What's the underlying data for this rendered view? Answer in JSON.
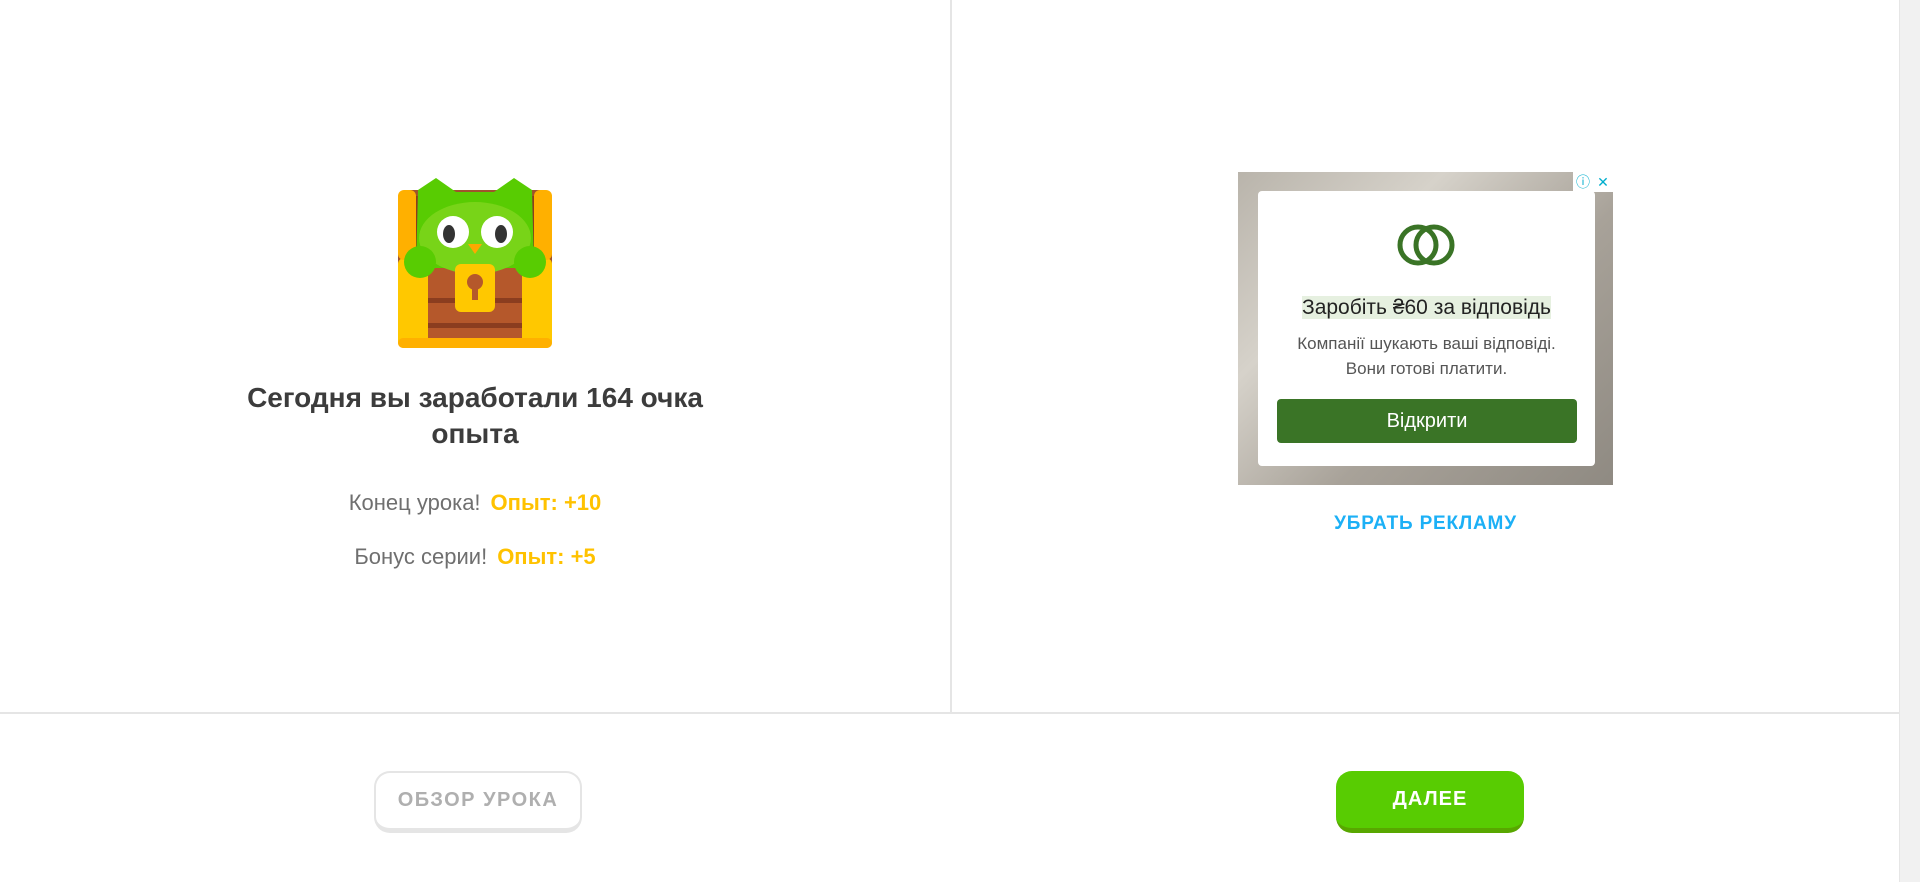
{
  "lesson_summary": {
    "title": "Сегодня вы заработали 164 очка опыта",
    "rows": [
      {
        "label": "Конец урока!",
        "value": "Опыт: +10"
      },
      {
        "label": "Бонус серии!",
        "value": "Опыт: +5"
      }
    ]
  },
  "ad": {
    "headline": "Заробіть ₴60 за відповідь",
    "body": "Компанії шукають ваші відповіді. Вони готові платити.",
    "button": "Відкрити",
    "info_icon": "info-icon",
    "close_icon": "close-icon"
  },
  "remove_ads": "УБРАТЬ РЕКЛАМУ",
  "footer": {
    "review_button": "ОБЗОР УРОКА",
    "next_button": "ДАЛЕЕ"
  },
  "colors": {
    "xp_yellow": "#ffc200",
    "next_green": "#58cc02",
    "ad_button_green": "#3a7426",
    "link_blue": "#1cb0f6"
  }
}
